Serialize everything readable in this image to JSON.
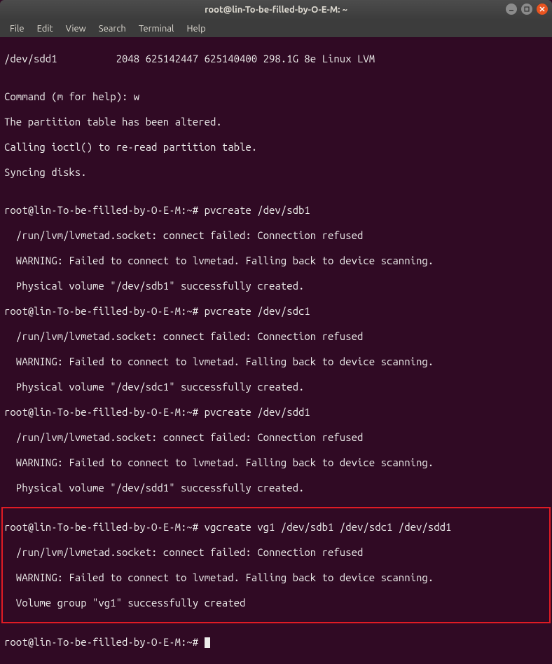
{
  "titlebar": {
    "title": "root@lin-To-be-filled-by-O-E-M: ~"
  },
  "menu": {
    "file": "File",
    "edit": "Edit",
    "view": "View",
    "search": "Search",
    "terminal": "Terminal",
    "help": "Help"
  },
  "term": {
    "l1": "/dev/sdd1          2048 625142447 625140400 298.1G 8e Linux LVM",
    "l2": "",
    "l3": "Command (m for help): w",
    "l4": "The partition table has been altered.",
    "l5": "Calling ioctl() to re-read partition table.",
    "l6": "Syncing disks.",
    "l7": "",
    "l8": "root@lin-To-be-filled-by-O-E-M:~# pvcreate /dev/sdb1",
    "l9": "  /run/lvm/lvmetad.socket: connect failed: Connection refused",
    "l10": "  WARNING: Failed to connect to lvmetad. Falling back to device scanning.",
    "l11": "  Physical volume \"/dev/sdb1\" successfully created.",
    "l12": "root@lin-To-be-filled-by-O-E-M:~# pvcreate /dev/sdc1",
    "l13": "  /run/lvm/lvmetad.socket: connect failed: Connection refused",
    "l14": "  WARNING: Failed to connect to lvmetad. Falling back to device scanning.",
    "l15": "  Physical volume \"/dev/sdc1\" successfully created.",
    "l16": "root@lin-To-be-filled-by-O-E-M:~# pvcreate /dev/sdd1",
    "l17": "  /run/lvm/lvmetad.socket: connect failed: Connection refused",
    "l18": "  WARNING: Failed to connect to lvmetad. Falling back to device scanning.",
    "l19": "  Physical volume \"/dev/sdd1\" successfully created.",
    "l20": "root@lin-To-be-filled-by-O-E-M:~# vgcreate vg1 /dev/sdb1 /dev/sdc1 /dev/sdd1",
    "l21": "  /run/lvm/lvmetad.socket: connect failed: Connection refused",
    "l22": "  WARNING: Failed to connect to lvmetad. Falling back to device scanning.",
    "l23": "  Volume group \"vg1\" successfully created",
    "l24": "root@lin-To-be-filled-by-O-E-M:~# "
  }
}
